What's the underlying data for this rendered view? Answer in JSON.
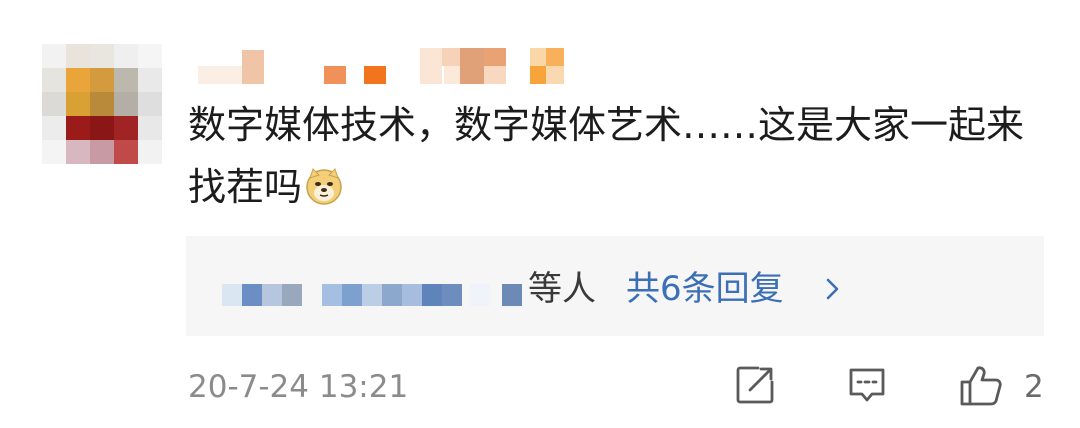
{
  "comment": {
    "text": "数字媒体技术，数字媒体艺术……这是大家一起来找茬吗",
    "emoji": "doge-emoji"
  },
  "replies": {
    "suffix": "等人",
    "link_label": "共6条回复"
  },
  "footer": {
    "timestamp": "20-7-24 13:21",
    "like_count": "2"
  },
  "icons": {
    "share": "share-edit-icon",
    "comment": "comment-icon",
    "like": "thumbs-up-icon",
    "chevron": "chevron-right-icon"
  },
  "colors": {
    "link": "#3b6fb6",
    "timestamp": "#8b8b8b",
    "reply_bg": "#f6f6f6"
  }
}
